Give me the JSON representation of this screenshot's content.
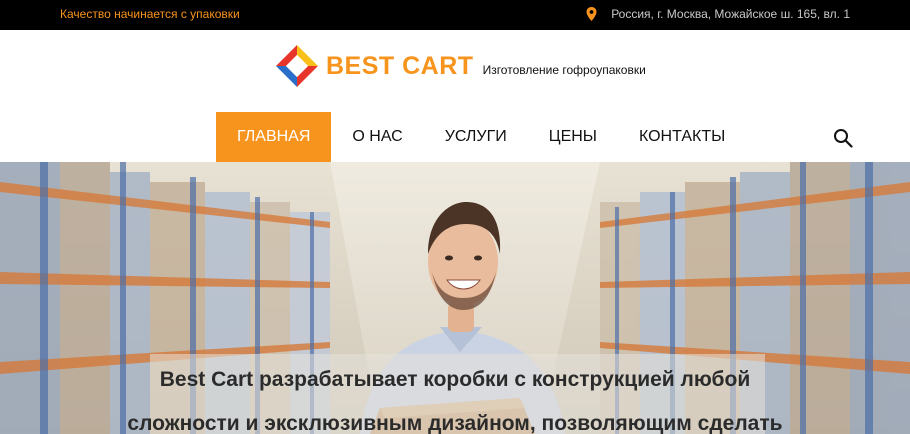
{
  "topbar": {
    "tagline": "Качество начинается с упаковки",
    "address": "Россия, г. Москва, Можайское ш. 165, вл. 1",
    "address_icon": "map-pin-icon"
  },
  "header": {
    "brand": "BEST CART",
    "subtitle": "Изготовление гофроупаковки"
  },
  "nav": {
    "items": [
      {
        "label": "ГЛАВНАЯ",
        "active": true
      },
      {
        "label": "О НАС",
        "active": false
      },
      {
        "label": "УСЛУГИ",
        "active": false
      },
      {
        "label": "ЦЕНЫ",
        "active": false
      },
      {
        "label": "КОНТАКТЫ",
        "active": false
      }
    ],
    "search_icon": "search-icon"
  },
  "hero": {
    "line1": "Best Cart разрабатывает коробки с конструкцией любой",
    "line2": "сложности и эксклюзивным дизайном, позволяющим сделать"
  },
  "colors": {
    "accent": "#f7941d",
    "topbar_bg": "#000000",
    "logo_red": "#e8352c",
    "logo_blue": "#2a6fc9",
    "logo_yellow": "#fbbf1a"
  }
}
